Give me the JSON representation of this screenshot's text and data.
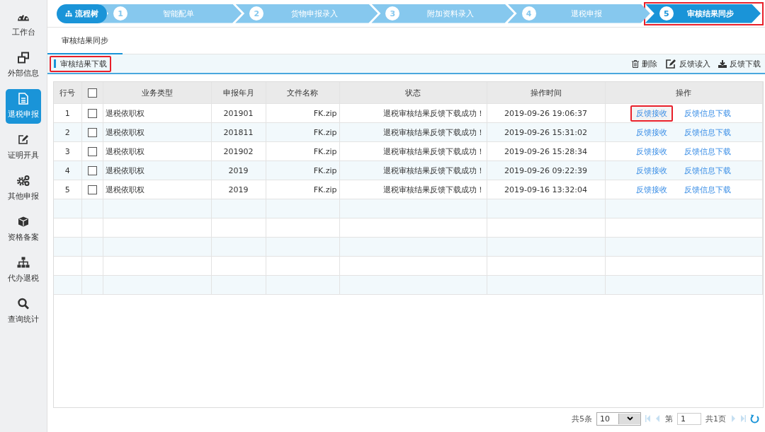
{
  "sidebar": {
    "items": [
      {
        "label": "工作台",
        "selected": false
      },
      {
        "label": "外部信息",
        "selected": false
      },
      {
        "label": "退税申报",
        "selected": true
      },
      {
        "label": "证明开具",
        "selected": false
      },
      {
        "label": "其他申报",
        "selected": false
      },
      {
        "label": "资格备案",
        "selected": false
      },
      {
        "label": "代办退税",
        "selected": false
      },
      {
        "label": "查询统计",
        "selected": false
      }
    ]
  },
  "steps": {
    "tree_label": "流程树",
    "items": [
      {
        "number": "1",
        "label": "智能配单",
        "selected": false,
        "highlighted": false
      },
      {
        "number": "2",
        "label": "货物申报录入",
        "selected": false,
        "highlighted": false
      },
      {
        "number": "3",
        "label": "附加资料录入",
        "selected": false,
        "highlighted": false
      },
      {
        "number": "4",
        "label": "退税申报",
        "selected": false,
        "highlighted": false
      },
      {
        "number": "5",
        "label": "审核结果同步",
        "selected": true,
        "highlighted": true
      }
    ]
  },
  "tabs": [
    {
      "label": "审核结果同步",
      "selected": true
    }
  ],
  "toolbar": {
    "title": "审核结果下载",
    "highlighted": true,
    "actions": [
      {
        "label": "删除"
      },
      {
        "label": "反馈读入"
      },
      {
        "label": "反馈下载"
      }
    ]
  },
  "table": {
    "columns": [
      "行号",
      "业务类型",
      "申报年月",
      "文件名称",
      "状态",
      "操作时间",
      "操作"
    ],
    "header_checked": false,
    "rows": [
      {
        "no": "1",
        "checked": false,
        "type": "退税依职权",
        "period": "201901",
        "file": "FK.zip",
        "status": "退税审核结果反馈下载成功！",
        "time": "2019-09-26 19:06:37",
        "actions": [
          {
            "label": "反馈接收",
            "highlighted": true
          },
          {
            "label": "反馈信息下载",
            "highlighted": false
          }
        ]
      },
      {
        "no": "2",
        "checked": false,
        "type": "退税依职权",
        "period": "201811",
        "file": "FK.zip",
        "status": "退税审核结果反馈下载成功！",
        "time": "2019-09-26 15:31:02",
        "actions": [
          {
            "label": "反馈接收",
            "highlighted": false
          },
          {
            "label": "反馈信息下载",
            "highlighted": false
          }
        ]
      },
      {
        "no": "3",
        "checked": false,
        "type": "退税依职权",
        "period": "201902",
        "file": "FK.zip",
        "status": "退税审核结果反馈下载成功！",
        "time": "2019-09-26 15:28:34",
        "actions": [
          {
            "label": "反馈接收",
            "highlighted": false
          },
          {
            "label": "反馈信息下载",
            "highlighted": false
          }
        ]
      },
      {
        "no": "4",
        "checked": false,
        "type": "退税依职权",
        "period": "2019",
        "file": "FK.zip",
        "status": "退税审核结果反馈下载成功！",
        "time": "2019-09-26 09:22:39",
        "actions": [
          {
            "label": "反馈接收",
            "highlighted": false
          },
          {
            "label": "反馈信息下载",
            "highlighted": false
          }
        ]
      },
      {
        "no": "5",
        "checked": false,
        "type": "退税依职权",
        "period": "2019",
        "file": "FK.zip",
        "status": "退税审核结果反馈下载成功！",
        "time": "2019-09-16 13:32:04",
        "actions": [
          {
            "label": "反馈接收",
            "highlighted": false
          },
          {
            "label": "反馈信息下载",
            "highlighted": false
          }
        ]
      }
    ]
  },
  "pager": {
    "total": "共5条",
    "page_size": "10",
    "page_label": "第",
    "page": "1",
    "pages": "共1页"
  }
}
